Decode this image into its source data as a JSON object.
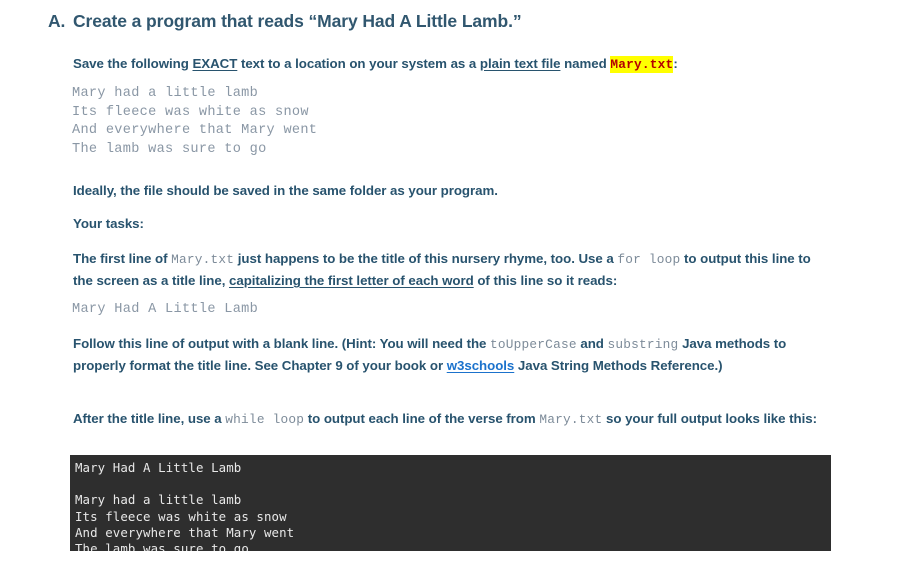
{
  "heading": {
    "marker": "A.",
    "text": "Create a program that reads “Mary Had A Little Lamb.”"
  },
  "instructions": {
    "save_text_1": "Save the following ",
    "save_text_exact": "EXACT",
    "save_text_2": " text to a location on your system as a ",
    "save_text_plain": "plain text file",
    "save_text_3": " named ",
    "save_text_file": "Mary.txt",
    "save_text_4": ":",
    "ideally": "Ideally, the file should be saved in the same folder as your program.",
    "your_tasks": "Your tasks:",
    "task1_1": "The first line of ",
    "task1_code_file": "Mary.txt",
    "task1_2": " just happens to be the title of this nursery rhyme, too. Use a ",
    "task1_code_for": "for loop",
    "task1_3": " to output this line to the screen as a title line, ",
    "task1_underline": "capitalizing the first letter of each word",
    "task1_4": " of this line so it reads:",
    "task2_1": "Follow this line of output with a blank line. (Hint: You will need the ",
    "task2_code_upper": "toUpperCase",
    "task2_2": " and ",
    "task2_code_substring": "substring",
    "task2_3": " Java methods to properly format the title line. See Chapter 9 of your book or ",
    "task2_link": "w3schools",
    "task2_4": " Java String Methods Reference.)",
    "task3_1": "After the title line, use a ",
    "task3_code_while": "while loop",
    "task3_2": " to output each line of the verse from ",
    "task3_code_file": "Mary.txt",
    "task3_3": " so your full output looks like this:"
  },
  "file_contents": {
    "lines": [
      "Mary had a little lamb",
      "Its fleece was white as snow",
      "And everywhere that Mary went",
      "The lamb was sure to go"
    ],
    "joined": "Mary had a little lamb\nIts fleece was white as snow\nAnd everywhere that Mary went\nThe lamb was sure to go"
  },
  "title_line_sample": "Mary Had A Little Lamb",
  "console_output": {
    "title": "Mary Had A Little Lamb",
    "lines": [
      "Mary had a little lamb",
      "Its fleece was white as snow",
      "And everywhere that Mary went",
      "The lamb was sure to go"
    ],
    "joined_body": "Mary had a little lamb\nIts fleece was white as snow\nAnd everywhere that Mary went\nThe lamb was sure to go"
  },
  "colors": {
    "body_text": "#28536e",
    "heading": "#31576f",
    "code_gray": "#7d8b99",
    "verse_gray": "#8a97a5",
    "highlight_bg": "#ffff00",
    "highlight_fg": "#b40000",
    "link": "#1b72cc",
    "console_bg": "#2e2e2e",
    "console_fg": "#e8e8e8"
  }
}
